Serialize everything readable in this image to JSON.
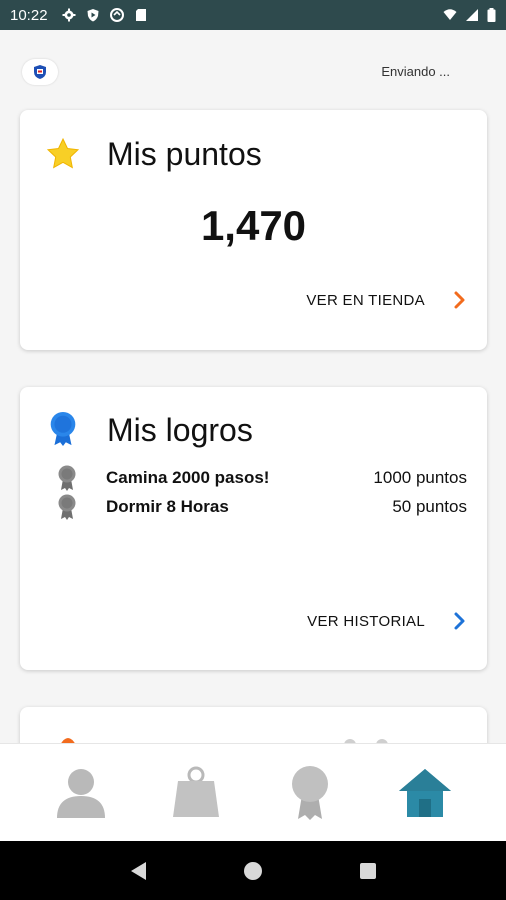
{
  "status_bar": {
    "time": "10:22",
    "left_icons": [
      "gear-icon",
      "shield-play-icon",
      "sync-icon",
      "sd-card-icon"
    ],
    "right_icons": [
      "wifi-icon",
      "signal-icon",
      "battery-icon"
    ]
  },
  "header": {
    "logo": "app-logo",
    "status_text": "Enviando ..."
  },
  "points_card": {
    "icon": "star-icon",
    "title": "Mis puntos",
    "value": "1,470",
    "link_label": "VER EN TIENDA",
    "accent": "#f26b1d"
  },
  "achievements_card": {
    "icon": "blue-medal-icon",
    "title": "Mis logros",
    "items": [
      {
        "name": "Camina 2000 pasos!",
        "points": "1000 puntos"
      },
      {
        "name": "Dormir 8 Horas",
        "points": "50 puntos"
      }
    ],
    "link_label": "VER HISTORIAL",
    "accent": "#1e73d8"
  },
  "bottom_nav": {
    "items": [
      "profile-icon",
      "shopping-bag-icon",
      "medal-icon",
      "home-icon"
    ],
    "active": "home-icon",
    "active_color": "#2b8aa6"
  },
  "system_nav": [
    "back-icon",
    "home-circle-icon",
    "recents-icon"
  ]
}
